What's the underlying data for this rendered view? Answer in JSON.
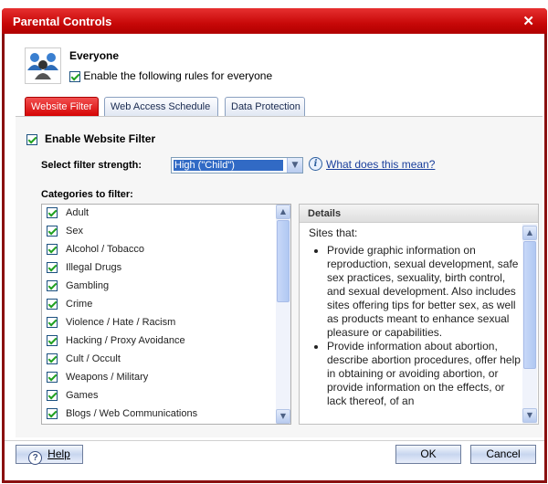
{
  "window": {
    "title": "Parental Controls",
    "close_icon": "close-icon"
  },
  "user": {
    "name": "Everyone",
    "enable_label": "Enable the following rules for everyone",
    "enabled": true,
    "icon": "users-group-icon"
  },
  "tabs": [
    {
      "label": "Website Filter",
      "active": true
    },
    {
      "label": "Web Access Schedule",
      "active": false
    },
    {
      "label": "Data Protection",
      "active": false
    }
  ],
  "filter": {
    "enable_label": "Enable Website Filter",
    "enabled": true,
    "strength_label": "Select filter strength:",
    "strength_value": "High (\"Child\")",
    "help_link": "What does this mean?",
    "categories_label": "Categories to filter:",
    "categories": [
      {
        "label": "Adult",
        "checked": true
      },
      {
        "label": "Sex",
        "checked": true
      },
      {
        "label": "Alcohol / Tobacco",
        "checked": true
      },
      {
        "label": "Illegal Drugs",
        "checked": true
      },
      {
        "label": "Gambling",
        "checked": true
      },
      {
        "label": "Crime",
        "checked": true
      },
      {
        "label": "Violence / Hate / Racism",
        "checked": true
      },
      {
        "label": "Hacking / Proxy Avoidance",
        "checked": true
      },
      {
        "label": "Cult / Occult",
        "checked": true
      },
      {
        "label": "Weapons / Military",
        "checked": true
      },
      {
        "label": "Games",
        "checked": true
      },
      {
        "label": "Blogs / Web Communications",
        "checked": true
      }
    ]
  },
  "details": {
    "header": "Details",
    "intro": "Sites that:",
    "bullets": [
      "Provide graphic information on reproduction, sexual development, safe sex practices, sexuality, birth control, and sexual development. Also includes sites offering tips for better sex, as well as products meant to enhance sexual pleasure or capabilities.",
      "Provide information about abortion, describe abortion procedures, offer help in obtaining or avoiding abortion, or provide information on the effects, or lack thereof, of an"
    ]
  },
  "buttons": {
    "help": "Help",
    "ok": "OK",
    "cancel": "Cancel"
  },
  "colors": {
    "title_bar": "#c80808",
    "active_tab": "#d40000",
    "selection": "#316ac5",
    "link": "#1a3f9c"
  }
}
